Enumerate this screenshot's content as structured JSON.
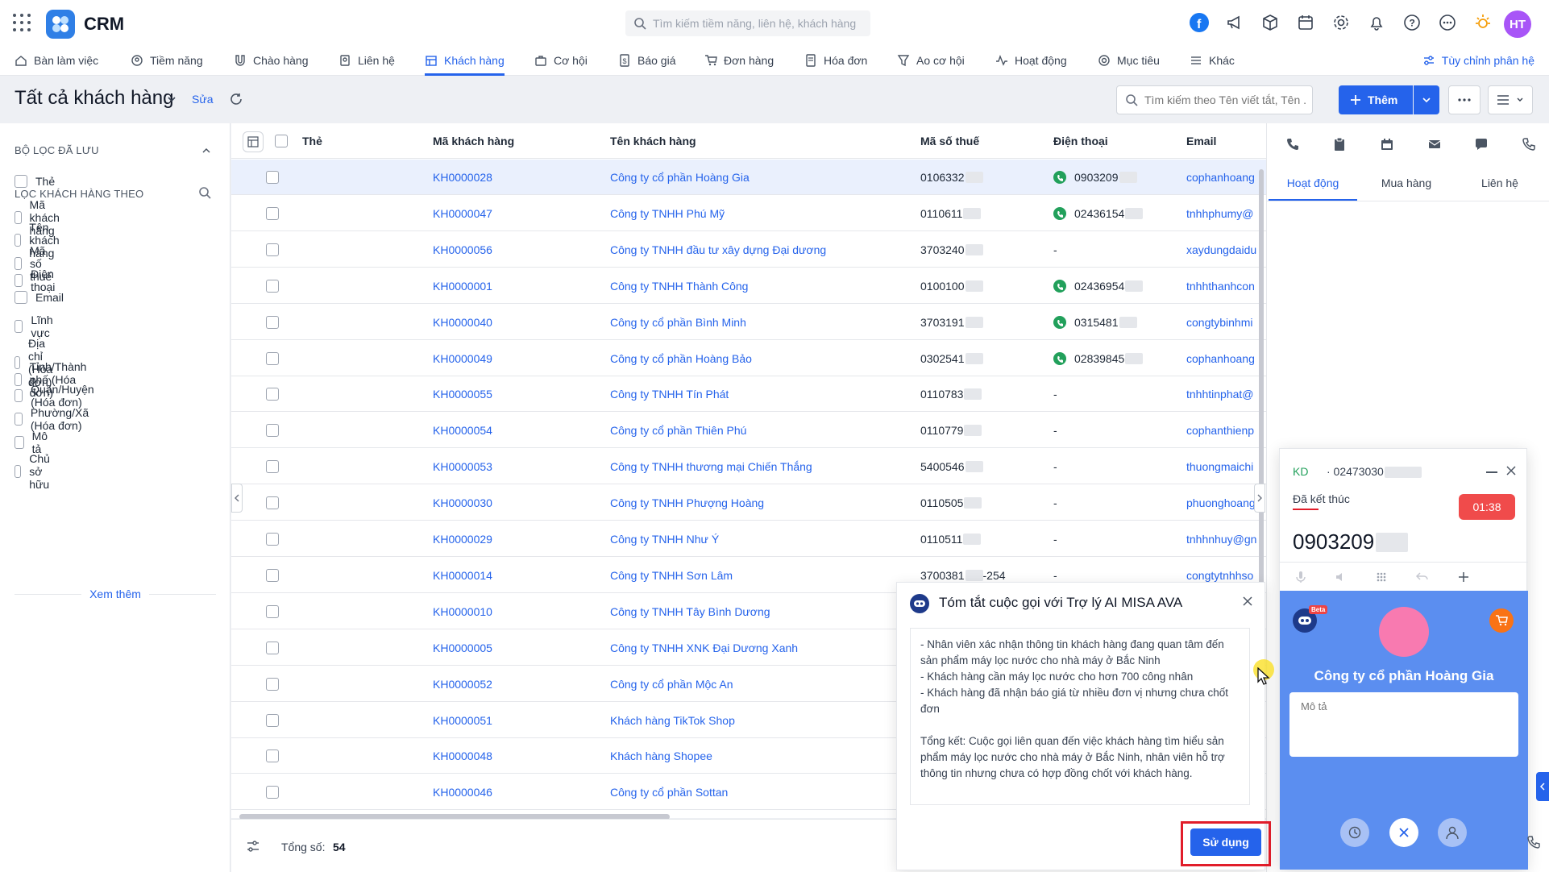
{
  "app": {
    "name": "CRM",
    "search_placeholder": "Tìm kiếm tiềm năng, liên hệ, khách hàng",
    "user_initials": "HT"
  },
  "nav": {
    "items": [
      "Bàn làm việc",
      "Tiềm năng",
      "Chào hàng",
      "Liên hệ",
      "Khách hàng",
      "Cơ hội",
      "Báo giá",
      "Đơn hàng",
      "Hóa đơn",
      "Ao cơ hội",
      "Hoạt động",
      "Mục tiêu",
      "Khác"
    ],
    "active": "Khách hàng",
    "customize": "Tùy chỉnh phân hệ"
  },
  "page": {
    "title": "Tất cả khách hàng",
    "edit": "Sửa",
    "search_placeholder": "Tìm kiếm theo Tên viết tắt, Tên ...",
    "add": "Thêm"
  },
  "filters": {
    "saved_heading": "BỘ LỌC ĐÃ LƯU",
    "by_heading": "LỌC KHÁCH HÀNG THEO",
    "items": [
      "Thẻ",
      "Mã khách hàng",
      "Tên khách hàng",
      "Mã số thuế",
      "Điện thoại",
      "Email",
      "Lĩnh vực",
      "Địa chỉ (Hóa đơn)",
      "Tỉnh/Thành phố (Hóa đơn)",
      "Quận/Huyện (Hóa đơn)",
      "Phường/Xã (Hóa đơn)",
      "Mô tả",
      "Chủ sở hữu"
    ],
    "see_more": "Xem thêm"
  },
  "table": {
    "headers": {
      "tag": "Thẻ",
      "code": "Mã khách hàng",
      "name": "Tên khách hàng",
      "tax": "Mã số thuế",
      "phone": "Điện thoại",
      "email": "Email"
    },
    "rows": [
      {
        "code": "KH0000028",
        "name": "Công ty cổ phần Hoàng Gia",
        "tax": "0106332",
        "tax_suffix": "",
        "phone": "0903209",
        "email": "cophanhoang"
      },
      {
        "code": "KH0000047",
        "name": "Công ty TNHH Phú Mỹ",
        "tax": "0110611",
        "tax_suffix": "",
        "phone": "02436154",
        "email": "tnhhphumy@"
      },
      {
        "code": "KH0000056",
        "name": "Công ty TNHH đầu tư xây dựng Đại dương",
        "tax": "3703240",
        "tax_suffix": "",
        "phone": "-",
        "email": "xaydungdaidu"
      },
      {
        "code": "KH0000001",
        "name": "Công ty TNHH Thành Công",
        "tax": "0100100",
        "tax_suffix": "",
        "phone": "02436954",
        "email": "tnhhthanhcon"
      },
      {
        "code": "KH0000040",
        "name": "Công ty cổ phần Bình Minh",
        "tax": "3703191",
        "tax_suffix": "",
        "phone": "0315481",
        "email": "congtybinhmi"
      },
      {
        "code": "KH0000049",
        "name": "Công ty cổ phần Hoàng Bảo",
        "tax": "0302541",
        "tax_suffix": "",
        "phone": "02839845",
        "email": "cophanhoang"
      },
      {
        "code": "KH0000055",
        "name": "Công ty TNHH Tín Phát",
        "tax": "0110783",
        "tax_suffix": "",
        "phone": "-",
        "email": "tnhhtinphat@"
      },
      {
        "code": "KH0000054",
        "name": "Công ty cổ phần Thiên Phú",
        "tax": "0110779",
        "tax_suffix": "",
        "phone": "-",
        "email": "cophanthienp"
      },
      {
        "code": "KH0000053",
        "name": "Công ty TNHH thương mại Chiến Thắng",
        "tax": "5400546",
        "tax_suffix": "",
        "phone": "-",
        "email": "thuongmaichi"
      },
      {
        "code": "KH0000030",
        "name": "Công ty TNHH Phượng Hoàng",
        "tax": "0110505",
        "tax_suffix": "",
        "phone": "-",
        "email": "phuonghoang"
      },
      {
        "code": "KH0000029",
        "name": "Công ty TNHH Như Ý",
        "tax": "0110511",
        "tax_suffix": "",
        "phone": "-",
        "email": "tnhhnhuy@gn"
      },
      {
        "code": "KH0000014",
        "name": "Công ty TNHH Sơn Lâm",
        "tax": "3700381",
        "tax_suffix": "-254",
        "phone": "-",
        "email": "congtytnhhso"
      },
      {
        "code": "KH0000010",
        "name": "Công ty TNHH Tây Bình Dương",
        "tax": "",
        "tax_suffix": "",
        "phone": "",
        "email": ""
      },
      {
        "code": "KH0000005",
        "name": "Công ty TNHH XNK Đại Dương Xanh",
        "tax": "",
        "tax_suffix": "",
        "phone": "",
        "email": ""
      },
      {
        "code": "KH0000052",
        "name": "Công ty cổ phần Mộc An",
        "tax": "",
        "tax_suffix": "",
        "phone": "",
        "email": ""
      },
      {
        "code": "KH0000051",
        "name": "Khách hàng TikTok Shop",
        "tax": "",
        "tax_suffix": "",
        "phone": "",
        "email": ""
      },
      {
        "code": "KH0000048",
        "name": "Khách hàng Shopee",
        "tax": "",
        "tax_suffix": "",
        "phone": "",
        "email": ""
      },
      {
        "code": "KH0000046",
        "name": "Công ty cổ phần Sottan",
        "tax": "",
        "tax_suffix": "",
        "phone": "",
        "email": ""
      }
    ],
    "total_label": "Tổng số:",
    "total": "54"
  },
  "right_panel": {
    "tabs": [
      "Hoạt động",
      "Mua hàng",
      "Liên hệ"
    ],
    "active": "Hoạt động"
  },
  "ai_summary": {
    "title": "Tóm tắt cuộc gọi với Trợ lý AI MISA AVA",
    "bullets": [
      "- Nhân viên xác nhận thông tin khách hàng đang quan tâm đến sản phẩm máy lọc nước cho nhà máy ở Bắc Ninh",
      "- Khách hàng cần máy lọc nước cho hơn 700 công nhân",
      "- Khách hàng đã nhận báo giá từ nhiều đơn vị nhưng chưa chốt đơn"
    ],
    "conclusion": "Tổng kết: Cuộc gọi liên quan đến việc khách hàng tìm hiểu sản phẩm máy lọc nước cho nhà máy ở Bắc Ninh, nhân viên hỗ trợ thông tin nhưng chưa có hợp đồng chốt với khách hàng.",
    "use_button": "Sử dụng"
  },
  "call": {
    "tag": "KD",
    "number_prefix": "· 02473030",
    "status": "Đã kết thúc",
    "timer": "01:38",
    "phone": "0903209",
    "company": "Công ty cổ phần Hoàng Gia",
    "desc_placeholder": "Mô tả",
    "beta": "Beta"
  },
  "colors": {
    "accent": "#2563eb",
    "whatsapp": "#22a05b",
    "call_panel": "#5b8ef0",
    "timer": "#f04b4b",
    "highlight": "#e11d2a"
  }
}
